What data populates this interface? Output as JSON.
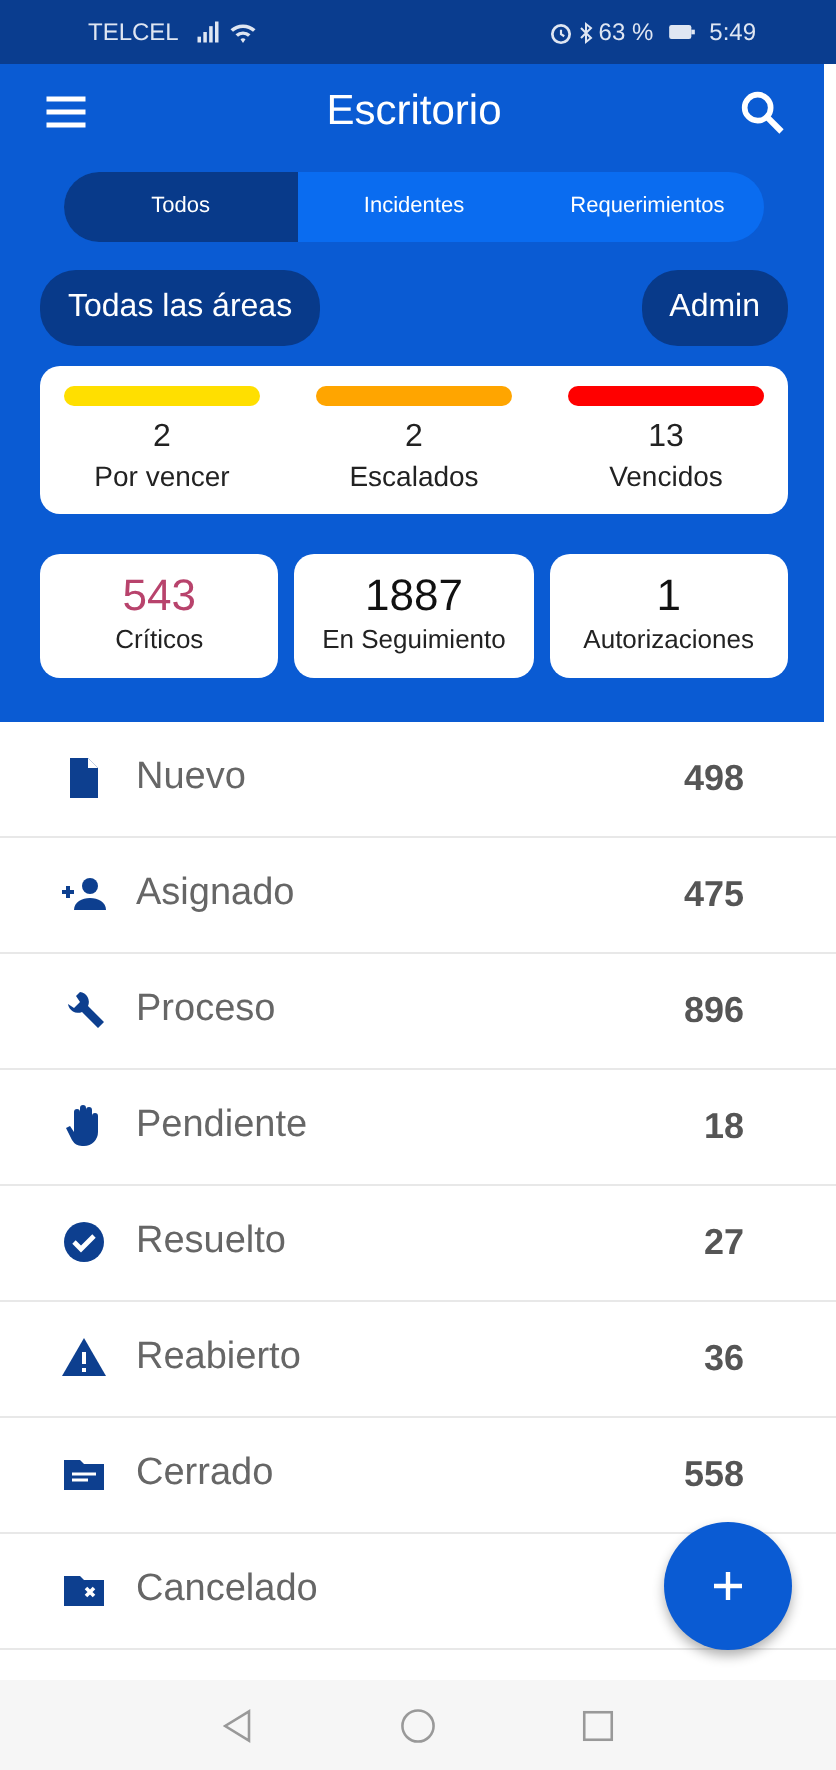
{
  "status_bar": {
    "carrier": "TELCEL",
    "battery": "63 %",
    "time": "5:49"
  },
  "app_bar": {
    "title": "Escritorio"
  },
  "tabs": [
    {
      "label": "Todos",
      "selected": true
    },
    {
      "label": "Incidentes",
      "selected": false
    },
    {
      "label": "Requerimientos",
      "selected": false
    }
  ],
  "filters": {
    "area": "Todas las áreas",
    "role": "Admin"
  },
  "deadlines": [
    {
      "count": "2",
      "label": "Por vencer",
      "color": "#ffdf00"
    },
    {
      "count": "2",
      "label": "Escalados",
      "color": "#ffa500"
    },
    {
      "count": "13",
      "label": "Vencidos",
      "color": "#ff0000"
    }
  ],
  "summary": [
    {
      "count": "543",
      "label": "Críticos",
      "color": "#b8436c"
    },
    {
      "count": "1887",
      "label": "En Seguimiento",
      "color": "#111111"
    },
    {
      "count": "1",
      "label": "Autorizaciones",
      "color": "#111111"
    }
  ],
  "statuses": [
    {
      "label": "Nuevo",
      "count": "498"
    },
    {
      "label": "Asignado",
      "count": "475"
    },
    {
      "label": "Proceso",
      "count": "896"
    },
    {
      "label": "Pendiente",
      "count": "18"
    },
    {
      "label": "Resuelto",
      "count": "27"
    },
    {
      "label": "Reabierto",
      "count": "36"
    },
    {
      "label": "Cerrado",
      "count": "558"
    },
    {
      "label": "Cancelado"
    }
  ]
}
